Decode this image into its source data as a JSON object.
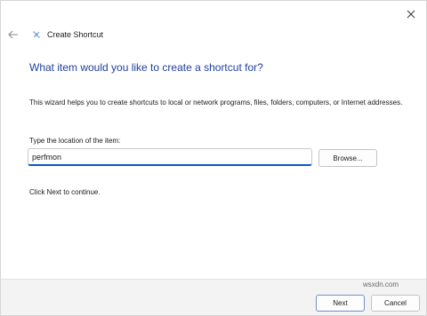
{
  "window": {
    "title": "Create Shortcut"
  },
  "wizard": {
    "heading": "What item would you like to create a shortcut for?",
    "description": "This wizard helps you to create shortcuts to local or network programs, files, folders, computers, or Internet addresses.",
    "field_label": "Type the location of the item:",
    "location_value": "perfmon",
    "browse_label": "Browse...",
    "hint": "Click Next to continue."
  },
  "footer": {
    "next_label": "Next",
    "cancel_label": "Cancel"
  },
  "watermark": "wsxdn.com",
  "icons": {
    "close": "close-icon",
    "back": "back-arrow-icon",
    "app": "shortcut-app-icon"
  },
  "colors": {
    "heading": "#1f3f9e",
    "input_focus": "#0a58c9",
    "footer_bg": "#f3f3f3"
  }
}
